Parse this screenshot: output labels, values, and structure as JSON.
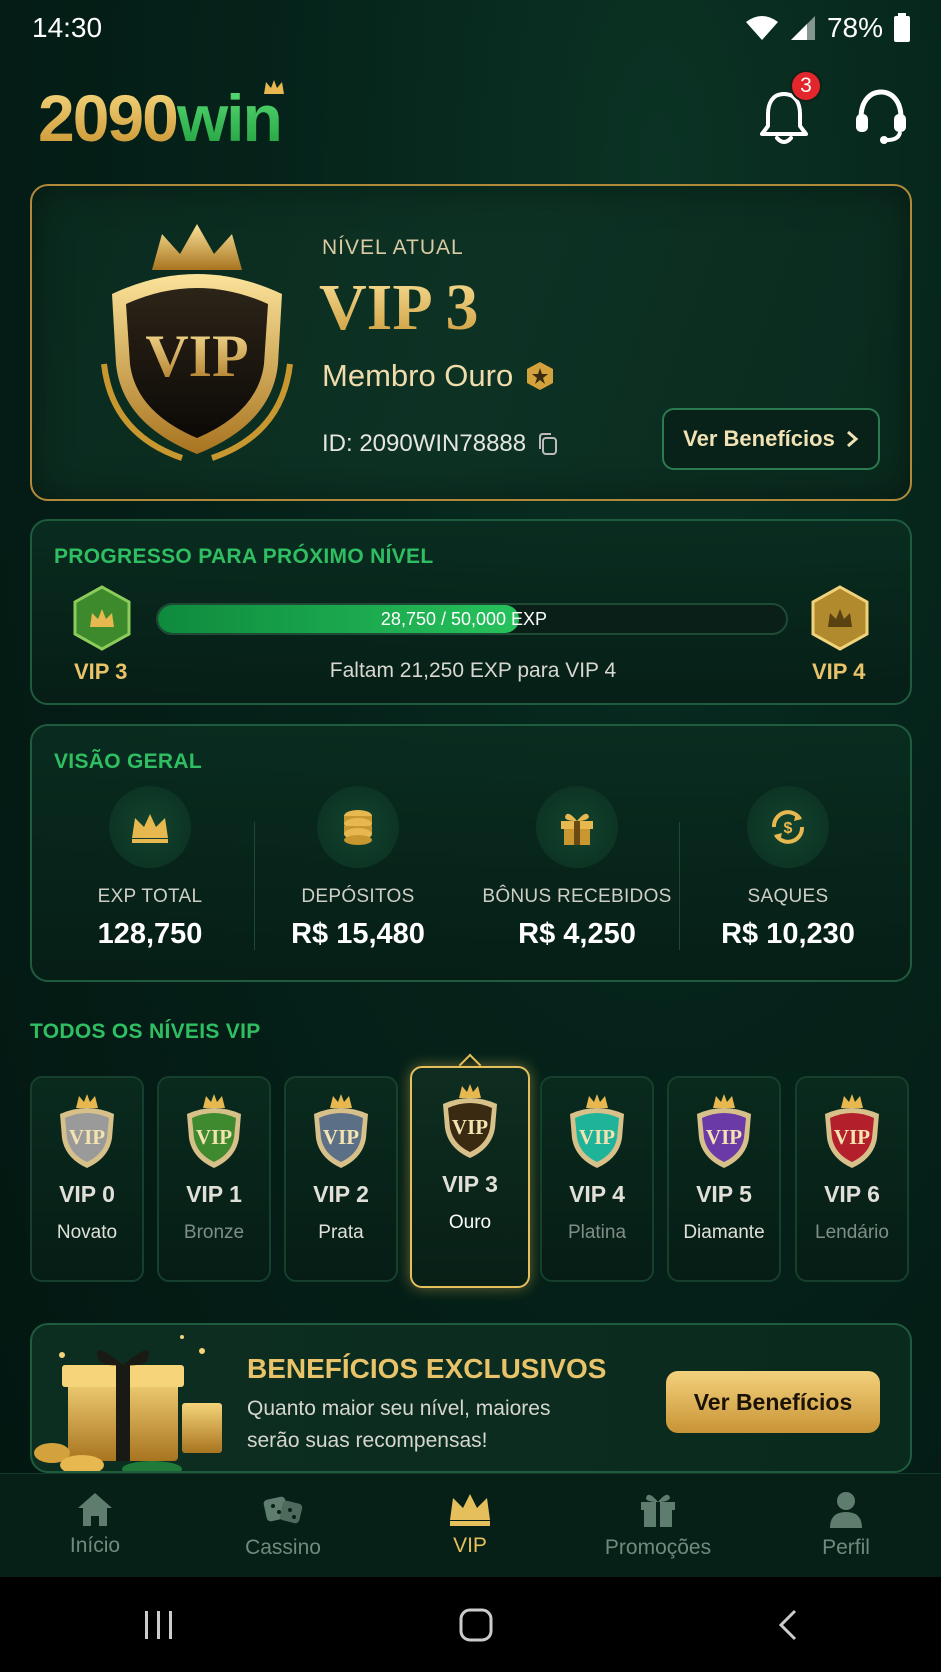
{
  "status": {
    "time": "14:30",
    "battery": "78%"
  },
  "header": {
    "logo_num": "2090",
    "logo_win": "win",
    "notifications": "3"
  },
  "vip_card": {
    "label": "NÍVEL ATUAL",
    "level": "VIP 3",
    "member": "Membro Ouro",
    "user_id": "ID: 2090WIN78888",
    "benefits_button": "Ver Benefícios",
    "shield_text": "VIP"
  },
  "progress": {
    "title": "PROGRESSO PARA PRÓXIMO NÍVEL",
    "current": "VIP 3",
    "next": "VIP 4",
    "exp_text": "28,750 / 50,000 EXP",
    "exp_fraction": 0.575,
    "remaining": "Faltam 21,250 EXP para VIP 4"
  },
  "overview": {
    "title": "VISÃO GERAL",
    "stats": [
      {
        "icon": "crown-icon",
        "label": "EXP TOTAL",
        "value": "128,750"
      },
      {
        "icon": "coins-icon",
        "label": "DEPÓSITOS",
        "value": "R$ 15,480"
      },
      {
        "icon": "gift-icon",
        "label": "BÔNUS RECEBIDOS",
        "value": "R$ 4,250"
      },
      {
        "icon": "withdraw-icon",
        "label": "SAQUES",
        "value": "R$ 10,230"
      }
    ]
  },
  "levels": {
    "title": "TODOS OS NÍVEIS VIP",
    "tiers": [
      {
        "name": "VIP 0",
        "sub": "Novato",
        "color": "#9a9a9a",
        "subcolor": "#e0e0d8"
      },
      {
        "name": "VIP 1",
        "sub": "Bronze",
        "color": "#3f8a2f",
        "subcolor": "#7f8f86"
      },
      {
        "name": "VIP 2",
        "sub": "Prata",
        "color": "#5b6f86",
        "subcolor": "#e0e0d8"
      },
      {
        "name": "VIP 3",
        "sub": "Ouro",
        "color": "#3a2a12",
        "subcolor": "#ffffff"
      },
      {
        "name": "VIP 4",
        "sub": "Platina",
        "color": "#1fb39a",
        "subcolor": "#7f8f86"
      },
      {
        "name": "VIP 5",
        "sub": "Diamante",
        "color": "#6a3aa6",
        "subcolor": "#e0e0d8"
      },
      {
        "name": "VIP 6",
        "sub": "Lendário",
        "color": "#b3202c",
        "subcolor": "#7f8f86"
      }
    ],
    "shield_text": "VIP"
  },
  "bonus": {
    "title": "BENEFÍCIOS EXCLUSIVOS",
    "desc": "Quanto maior seu nível, maiores serão suas recompensas!",
    "button": "Ver Benefícios"
  },
  "nav": [
    {
      "label": "Início",
      "icon": "home-icon"
    },
    {
      "label": "Cassino",
      "icon": "dice-icon"
    },
    {
      "label": "VIP",
      "icon": "crown-icon"
    },
    {
      "label": "Promoções",
      "icon": "gift-icon"
    },
    {
      "label": "Perfil",
      "icon": "user-icon"
    }
  ],
  "colors": {
    "gold": "#e9c36a",
    "green": "#2fbf62",
    "background": "#041a12"
  }
}
